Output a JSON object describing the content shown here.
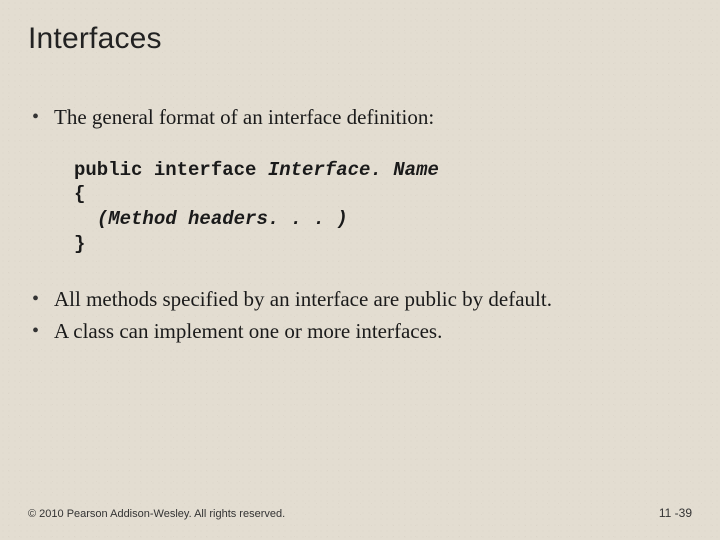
{
  "title": "Interfaces",
  "bullets_top": [
    "The general format of an interface definition:"
  ],
  "code": {
    "line1_plain": "public interface ",
    "line1_ital": "Interface. Name",
    "line2": "{",
    "line3_indent": "  ",
    "line3_ital": "(Method headers. . . )",
    "line4": "}"
  },
  "bullets_bottom": [
    "All methods specified by an interface are public by default.",
    "A class can implement one or more interfaces."
  ],
  "footer": {
    "copyright": "© 2010 Pearson Addison-Wesley. All rights reserved.",
    "page": "11 -39"
  }
}
